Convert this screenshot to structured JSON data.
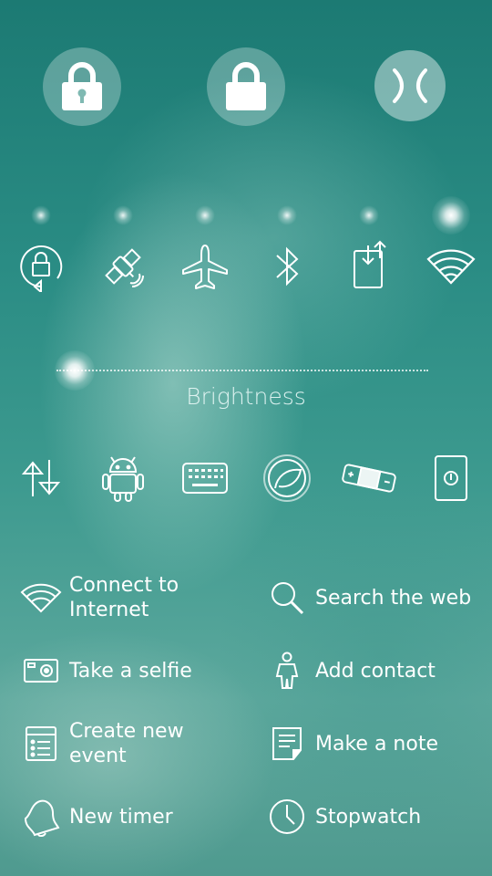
{
  "top_actions": [
    {
      "name": "lock-device",
      "icon": "padlock-closed-icon"
    },
    {
      "name": "lock-screen",
      "icon": "padlock-open-icon"
    },
    {
      "name": "close",
      "icon": "sailfish-close-icon"
    }
  ],
  "switches_row1": [
    {
      "id": "orientation-lock",
      "icon": "rotation-lock-icon",
      "active": false
    },
    {
      "id": "gps",
      "icon": "satellite-icon",
      "active": false
    },
    {
      "id": "flight-mode",
      "icon": "airplane-icon",
      "active": false
    },
    {
      "id": "bluetooth",
      "icon": "bluetooth-icon",
      "active": false
    },
    {
      "id": "usb-mode",
      "icon": "usb-transfer-icon",
      "active": false
    },
    {
      "id": "wifi",
      "icon": "wifi-icon",
      "active": true
    }
  ],
  "brightness": {
    "label": "Brightness",
    "level": 0.05
  },
  "switches_row2": [
    {
      "id": "mobile-data",
      "icon": "data-arrows-icon"
    },
    {
      "id": "android-support",
      "icon": "android-icon"
    },
    {
      "id": "keyboard",
      "icon": "keyboard-icon"
    },
    {
      "id": "ambience",
      "icon": "ambience-icon"
    },
    {
      "id": "tethering",
      "icon": "patch-icon"
    },
    {
      "id": "power",
      "icon": "power-icon"
    }
  ],
  "shortcuts": [
    {
      "label": "Connect to\nInternet",
      "icon": "wifi-icon"
    },
    {
      "label": "Search the web",
      "icon": "search-icon"
    },
    {
      "label": "Take a selfie",
      "icon": "camera-icon"
    },
    {
      "label": "Add contact",
      "icon": "person-icon"
    },
    {
      "label": "Create new\nevent",
      "icon": "calendar-list-icon"
    },
    {
      "label": "Make a note",
      "icon": "note-icon"
    },
    {
      "label": "New timer",
      "icon": "bell-icon"
    },
    {
      "label": "Stopwatch",
      "icon": "clock-icon"
    }
  ]
}
